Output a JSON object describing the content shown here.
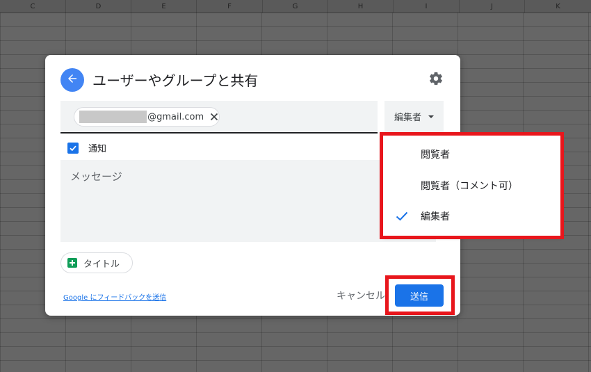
{
  "sheet": {
    "columns": [
      "C",
      "D",
      "E",
      "F",
      "G",
      "H",
      "I",
      "J",
      "K"
    ]
  },
  "dialog": {
    "title": "ユーザーやグループと共有",
    "recipient": {
      "email_suffix": "@gmail.com"
    },
    "role_button_label": "編集者",
    "notify_label": "通知",
    "notify_checked": true,
    "message_placeholder": "メッセージ",
    "attachment_label": "タイトル",
    "feedback_link": "Google にフィードバックを送信",
    "cancel_label": "キャンセル",
    "send_label": "送信"
  },
  "role_menu": {
    "items": [
      {
        "label": "閲覧者",
        "selected": false
      },
      {
        "label": "閲覧者（コメント可）",
        "selected": false
      },
      {
        "label": "編集者",
        "selected": true
      }
    ]
  },
  "colors": {
    "accent": "#1a73e8",
    "highlight": "#e8161c",
    "sheets_green": "#0f9d58"
  }
}
